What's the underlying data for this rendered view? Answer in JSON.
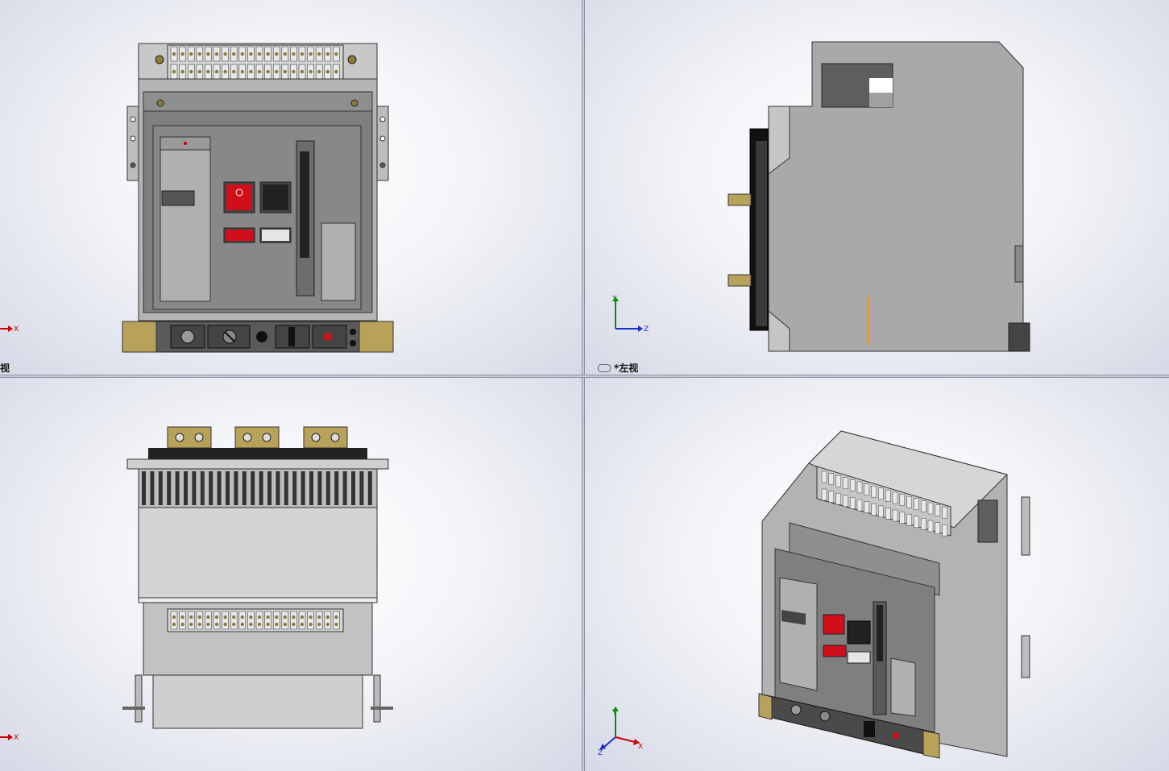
{
  "viewports": {
    "top_left": {
      "label": "视",
      "triad_x": "X"
    },
    "top_right": {
      "label": "*左视",
      "triad_x": "Z",
      "triad_y": "Y"
    },
    "bottom_left": {
      "label": "",
      "triad_x": "X"
    },
    "bottom_right": {
      "label": "",
      "triad_x": "X",
      "triad_y": "Y",
      "triad_z": "Z"
    }
  },
  "colors": {
    "background_center": "#ffffff",
    "background_edge": "#d6d9e6",
    "body_gray": "#a8a8a8",
    "dark_gray": "#5a5a5a",
    "terminal_bronze": "#b8a25a",
    "accent_red": "#d10f1a",
    "indicator_orange": "#ff8c00"
  },
  "icons": [
    "coordinate-triad-icon",
    "view-link-icon"
  ]
}
